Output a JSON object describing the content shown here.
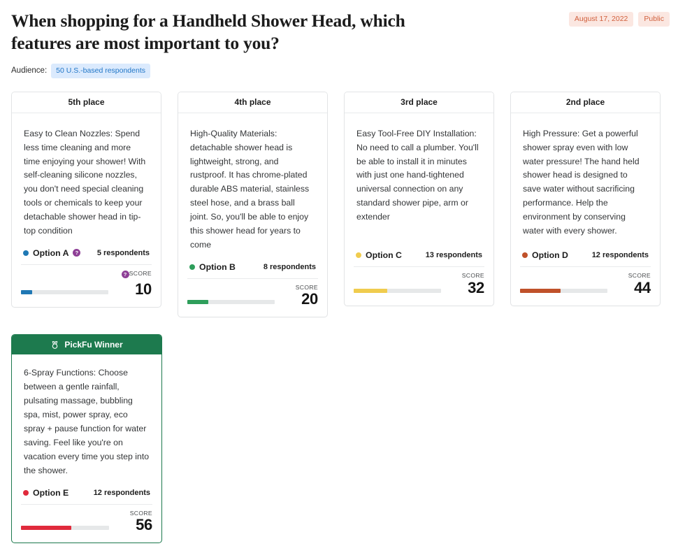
{
  "header": {
    "title": "When shopping for a Handheld Shower Head, which features are most important to you?",
    "date_badge": "August 17, 2022",
    "visibility_badge": "Public",
    "audience_label": "Audience:",
    "audience_value": "50 U.S.-based respondents"
  },
  "labels": {
    "score_caption": "SCORE",
    "winner_banner": "PickFu Winner",
    "help_glyph": "?",
    "medal_icon": "award-medal-icon"
  },
  "colors": {
    "option_a": "#1f78b4",
    "option_b": "#2e9e5b",
    "option_c": "#f0cc4e",
    "option_d": "#c0512a",
    "option_e": "#e02a3c",
    "winner_green": "#1d7a4e",
    "badge_peach_bg": "#fbe7e1",
    "badge_peach_fg": "#d1603d",
    "badge_blue_bg": "#dbeafd",
    "badge_blue_fg": "#2176c7",
    "help_purple": "#8e3f96",
    "bar_track": "#e6e8e9"
  },
  "cards": [
    {
      "place": "5th place",
      "text": "Easy to Clean Nozzles: Spend less time cleaning and more time enjoying your shower! With self-cleaning silicone nozzles, you don't need special cleaning tools or chemicals to keep your detachable shower head in tip-top condition",
      "option": "Option A",
      "respondents": "5 respondents",
      "score": "10",
      "score_pct": 13,
      "color": "#1f78b4",
      "has_option_help": true,
      "has_score_help": true,
      "winner": false
    },
    {
      "place": "4th place",
      "text": "High-Quality Materials: detachable shower head is lightweight, strong, and rustproof. It has chrome-plated durable ABS material, stainless steel hose, and a brass ball joint. So, you'll be able to enjoy this shower head for years to come",
      "option": "Option B",
      "respondents": "8 respondents",
      "score": "20",
      "score_pct": 24,
      "color": "#2e9e5b",
      "has_option_help": false,
      "has_score_help": false,
      "winner": false
    },
    {
      "place": "3rd place",
      "text": "Easy Tool-Free DIY Installation: No need to call a plumber. You'll be able to install it in minutes with just one hand-tightened universal connection on any standard shower pipe, arm or extender",
      "option": "Option C",
      "respondents": "13 respondents",
      "score": "32",
      "score_pct": 38,
      "color": "#f0cc4e",
      "has_option_help": false,
      "has_score_help": false,
      "winner": false
    },
    {
      "place": "2nd place",
      "text": "High Pressure: Get a powerful shower spray even with low water pressure! The hand held shower head is designed to save water without sacrificing performance. Help the environment by conserving water with every shower.",
      "option": "Option D",
      "respondents": "12 respondents",
      "score": "44",
      "score_pct": 46,
      "color": "#c0512a",
      "has_option_help": false,
      "has_score_help": false,
      "winner": false
    },
    {
      "place": "PickFu Winner",
      "text": "6-Spray Functions: Choose between a gentle rainfall, pulsating massage, bubbling spa, mist, power spray, eco spray + pause function for water saving. Feel like you're on vacation every time you step into the shower.",
      "option": "Option E",
      "respondents": "12 respondents",
      "score": "56",
      "score_pct": 57,
      "color": "#e02a3c",
      "has_option_help": false,
      "has_score_help": false,
      "winner": true
    }
  ]
}
